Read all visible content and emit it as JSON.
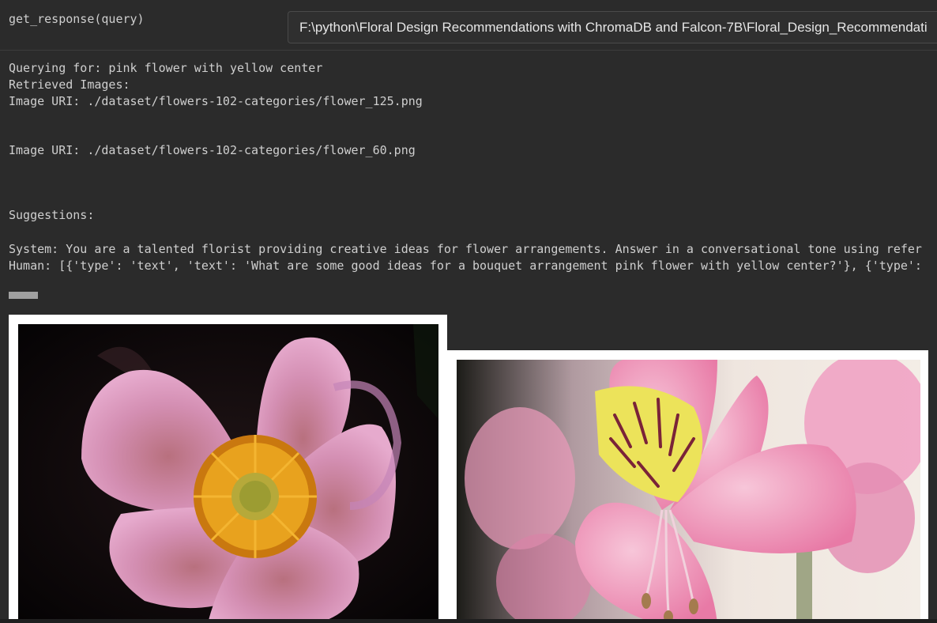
{
  "cell": {
    "call": "get_response(query)"
  },
  "tooltip": {
    "path": "F:\\python\\Floral Design Recommendations with ChromaDB and Falcon-7B\\Floral_Design_Recommendati"
  },
  "output": {
    "query_line": "Querying for: pink flower with yellow center",
    "retrieved_line": "Retrieved Images:",
    "uri_1": "Image URI: ./dataset/flowers-102-categories/flower_125.png",
    "uri_2": "Image URI: ./dataset/flowers-102-categories/flower_60.png",
    "suggestions": "Suggestions:",
    "system_line": "System: You are a talented florist providing creative ideas for flower arrangements. Answer in a conversational tone using refer",
    "human_line": "Human: [{'type': 'text', 'text': 'What are some good ideas for a bouquet arrangement pink flower with yellow center?'}, {'type':"
  },
  "images": [
    {
      "label": "flower_125",
      "subject": "pink flower with orange-yellow center on black background",
      "petal_color": "#d98fb4",
      "center_color": "#e8a21e"
    },
    {
      "label": "flower_60",
      "subject": "pink alstroemeria with yellow center and dark streaks",
      "petal_color": "#ee8fb5",
      "center_color": "#ece35a"
    }
  ]
}
